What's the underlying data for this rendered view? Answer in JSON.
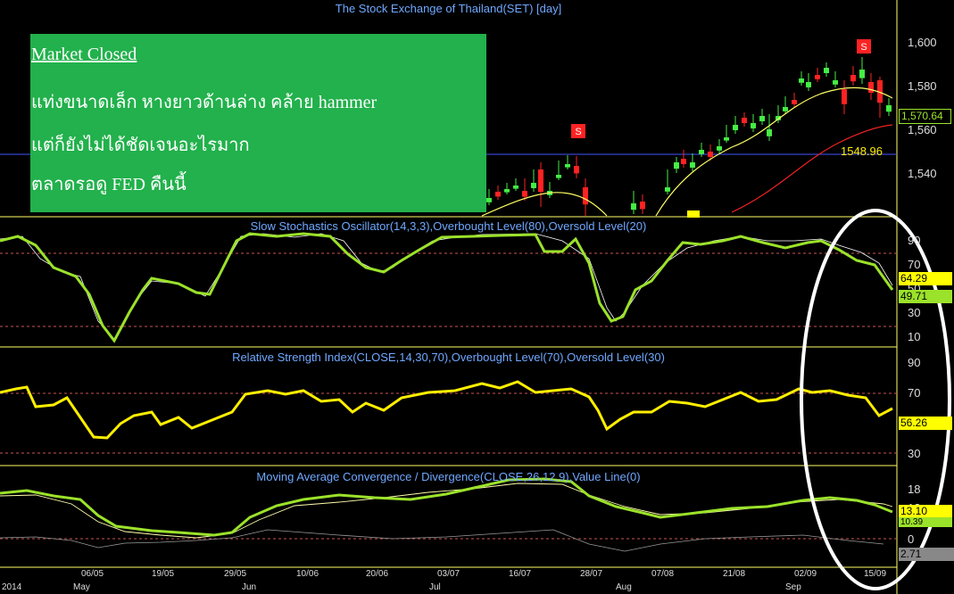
{
  "window": {
    "title": "The Stock Exchange of Thailand(SET) [day]"
  },
  "note": {
    "line1": "Market Closed",
    "line2": "แท่งขนาดเล็ก หางยาวด้านล่าง คล้าย hammer",
    "line3": "แต่ก็ยังไม่ได้ชัดเจนอะไรมาก",
    "line4": "ตลาดรอดู FED คืนนี้"
  },
  "price_panel": {
    "y_labels": [
      "1,600",
      "1,580",
      "1,560",
      "1,540"
    ],
    "last_price_tag": "1,570.64",
    "reference_level": "1548.96",
    "signal_label": "S"
  },
  "stoch_panel": {
    "title": "Slow Stochastics Oscillator(14,3,3),Overbought Level(80),Oversold Level(20)",
    "y_labels": [
      "90",
      "70",
      "50",
      "30",
      "10"
    ],
    "tag_k": "64.29",
    "tag_d": "49.71"
  },
  "rsi_panel": {
    "title": "Relative Strength Index(CLOSE,14,30,70),Overbought Level(70),Oversold Level(30)",
    "y_labels": [
      "90",
      "70",
      "50",
      "30"
    ],
    "tag_value": "56.26"
  },
  "macd_panel": {
    "title": "Moving Average Convergence / Divergence(CLOSE,26,12,9),Value Line(0)",
    "y_labels": [
      "18",
      "12",
      "6",
      "0"
    ],
    "tag_macd": "13.10",
    "tag_signal": "10.39",
    "tag_hist": "2.71"
  },
  "x_axis": {
    "dates": [
      "06/05",
      "19/05",
      "29/05",
      "10/06",
      "20/06",
      "03/07",
      "16/07",
      "28/07",
      "07/08",
      "21/08",
      "02/09",
      "15/09"
    ],
    "months": [
      "2014",
      "May",
      "Jun",
      "Jul",
      "Aug",
      "Sep"
    ]
  },
  "colors": {
    "note_bg": "#22b14c",
    "stoch_k": "#9be22a",
    "rsi": "#ffee00",
    "panel_border": "#ffff66",
    "title_blue": "#6fa8ff",
    "signal_red": "#ff2222"
  }
}
